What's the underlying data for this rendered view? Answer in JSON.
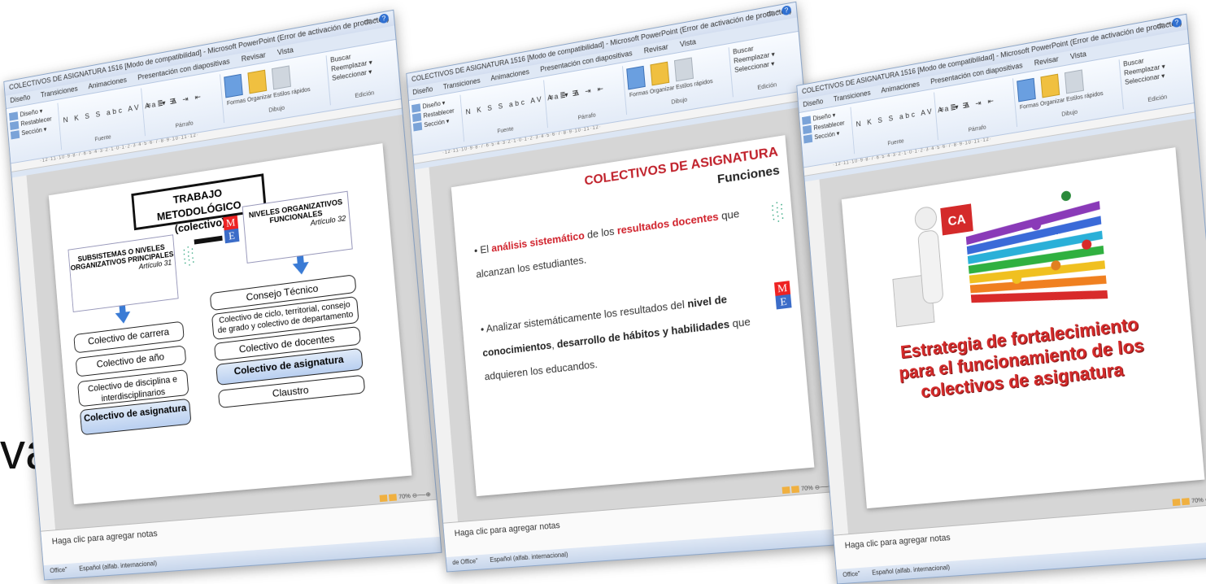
{
  "partial_word": "vas",
  "windows": [
    {
      "title": "COLECTIVOS DE ASIGNATURA 1516 [Modo de compatibilidad] - Microsoft PowerPoint (Error de activación de productos)",
      "tabs": [
        "Diseño",
        "Transiciones",
        "Animaciones",
        "Presentación con diapositivas",
        "Revisar",
        "Vista"
      ],
      "ribbon": {
        "diseno": "Diseño ▾",
        "restablecer": "Restablecer",
        "seccion": "Sección ▾",
        "fuente_label": "Fuente",
        "parrafo_label": "Párrafo",
        "dibujo_label": "Dibujo",
        "edicion_label": "Edición",
        "formas": "Formas",
        "organizar": "Organizar",
        "estilos": "Estilos rápidos",
        "buscar": "Buscar",
        "reemplazar": "Reemplazar ▾",
        "seleccionar": "Seleccionar ▾",
        "fmt": "N K S S abc AV Aa ▾ A"
      },
      "sidebar_label": "positivas",
      "notes": "Haga clic para agregar notas",
      "status": [
        "Office\"",
        "Español (alfab. internacional)"
      ],
      "zoom": "70%"
    },
    {
      "title": "COLECTIVOS DE ASIGNATURA 1516 [Modo de compatibilidad] - Microsoft PowerPoint (Error de activación de productos)",
      "tabs": [
        "Diseño",
        "Transiciones",
        "Animaciones",
        "Presentación con diapositivas",
        "Revisar",
        "Vista"
      ],
      "ribbon": {
        "diseno": "Diseño ▾",
        "restablecer": "Restablecer",
        "seccion": "Sección ▾",
        "fuente_label": "Fuente",
        "parrafo_label": "Párrafo",
        "dibujo_label": "Dibujo",
        "edicion_label": "Edición",
        "formas": "Formas",
        "organizar": "Organizar",
        "estilos": "Estilos rápidos",
        "buscar": "Buscar",
        "reemplazar": "Reemplazar ▾",
        "seleccionar": "Seleccionar ▾",
        "fmt": "N K S S abc AV Aa ▾ A"
      },
      "sidebar_label": "positivas",
      "notes": "Haga clic para agregar notas",
      "status": [
        "de Office\"",
        "Español (alfab. internacional)"
      ],
      "zoom": "70%"
    },
    {
      "title": "COLECTIVOS DE ASIGNATURA 1516 [Modo de compatibilidad] - Microsoft PowerPoint (Error de activación de productos)",
      "tabs": [
        "Diseño",
        "Transiciones",
        "Animaciones",
        "Presentación con diapositivas",
        "Revisar",
        "Vista"
      ],
      "ribbon": {
        "diseno": "Diseño ▾",
        "restablecer": "Restablecer",
        "seccion": "Sección ▾",
        "fuente_label": "Fuente",
        "parrafo_label": "Párrafo",
        "dibujo_label": "Dibujo",
        "edicion_label": "Edición",
        "formas": "Formas",
        "organizar": "Organizar",
        "estilos": "Estilos rápidos",
        "buscar": "Buscar",
        "reemplazar": "Reemplazar ▾",
        "seleccionar": "Seleccionar ▾",
        "fmt": "N K S S abc AV Aa ▾ A"
      },
      "sidebar_label": "itivas",
      "notes": "Haga clic para agregar notas",
      "status": [
        "Office\"",
        "Español (alfab. internacional)"
      ],
      "zoom": "70%"
    }
  ],
  "slide1": {
    "title_line1": "TRABAJO METODOLÓGICO",
    "title_line2": "(colectivo)",
    "left_box_title": "SUBSISTEMAS O NIVELES ORGANIZATIVOS PRINCIPALES",
    "left_box_article": "Artículo 31",
    "right_box_title": "NIVELES ORGANIZATIVOS FUNCIONALES",
    "right_box_article": "Artículo 32",
    "left_items": [
      "Colectivo de carrera",
      "Colectivo de año",
      "Colectivo de disciplina e interdisciplinarios",
      "Colectivo de asignatura"
    ],
    "right_items": [
      "Consejo Técnico",
      "Colectivo de ciclo, territorial, consejo de grado y colectivo de departamento",
      "Colectivo de docentes",
      "Colectivo de asignatura",
      "Claustro"
    ],
    "logo_m": "M",
    "logo_e": "E"
  },
  "slide2": {
    "title": "COLECTIVOS DE ASIGNATURA",
    "subtitle": "Funciones",
    "b1_pre": "El ",
    "b1_red1": "análisis sistemático",
    "b1_mid": " de los ",
    "b1_red2": "resultados docentes",
    "b1_post": " que alcanzan los estudiantes.",
    "b2_pre": "Analizar sistemáticamente los resultados del ",
    "b2_bold1": "nivel de conocimientos",
    "b2_mid1": ", ",
    "b2_bold2": "desarrollo de hábitos y habilidades",
    "b2_post": " que adquieren los educandos.",
    "logo_m": "M",
    "logo_e": "E"
  },
  "slide3": {
    "badge": "CA",
    "caption_l1": "Estrategia de fortalecimiento",
    "caption_l2": "para el funcionamiento de los",
    "caption_l3": "colectivos de asignatura"
  }
}
